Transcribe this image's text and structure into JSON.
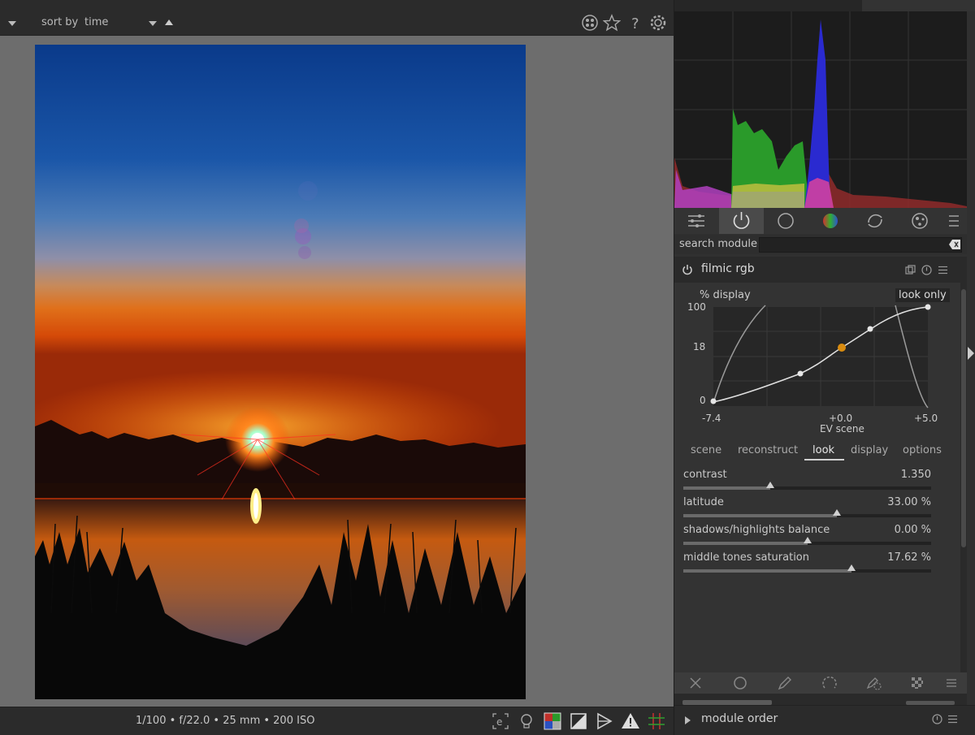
{
  "topbar": {
    "sort_label": "sort by",
    "sort_value": "time",
    "icons": [
      "color-labels-icon",
      "star-icon",
      "help-icon",
      "gear-icon"
    ]
  },
  "search": {
    "label": "search module",
    "value": ""
  },
  "module_tabs": [
    "presets-icon",
    "power-icon",
    "circle-icon",
    "color-icon",
    "correct-icon",
    "effect-icon",
    "menu-icon"
  ],
  "module": {
    "name": "filmic rgb",
    "graph": {
      "y_title": "% display",
      "view_button": "look only",
      "y_ticks": [
        "100",
        "18",
        "0"
      ],
      "x_ticks": [
        "-7.4",
        "+0.0",
        "+5.0"
      ],
      "x_title": "EV scene"
    },
    "tabs": [
      {
        "label": "scene",
        "active": false
      },
      {
        "label": "reconstruct",
        "active": false
      },
      {
        "label": "look",
        "active": true
      },
      {
        "label": "display",
        "active": false
      },
      {
        "label": "options",
        "active": false
      }
    ],
    "sliders": [
      {
        "label": "contrast",
        "value": "1.350",
        "fraction": 0.35
      },
      {
        "label": "latitude",
        "value": "33.00 %",
        "fraction": 0.62
      },
      {
        "label": "shadows/highlights balance",
        "value": "0.00 %",
        "fraction": 0.5
      },
      {
        "label": "middle tones saturation",
        "value": "17.62 %",
        "fraction": 0.68
      }
    ]
  },
  "bottombar": {
    "exif": "1/100 • f/22.0 • 25 mm • 200 ISO"
  },
  "module_order": {
    "label": "module order"
  },
  "colors": {
    "panel": "#303030",
    "accent_orange": "#d98c10"
  }
}
